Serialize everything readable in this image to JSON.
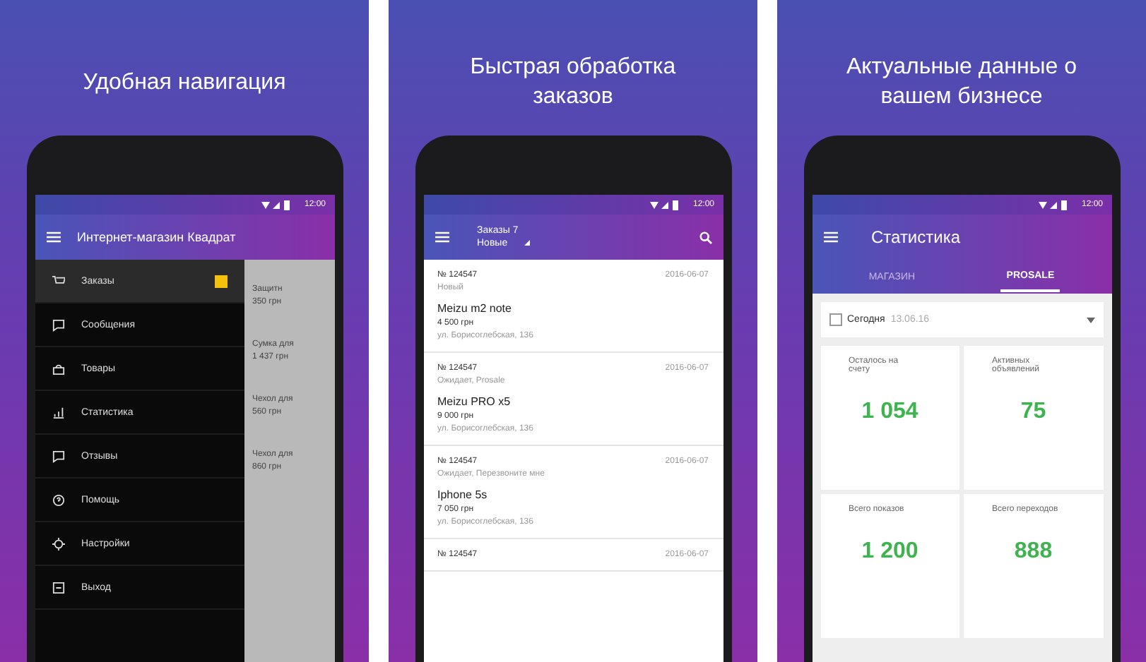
{
  "panels": [
    {
      "kind": "navigation",
      "headline": "Удобная навигация",
      "time": "12:00",
      "appbar_title": "Интернет-магазин Квадрат",
      "drawer_items": [
        {
          "label": "Заказы",
          "selected": true,
          "badge": true
        },
        {
          "label": "Сообщения",
          "selected": false,
          "badge": false
        },
        {
          "label": "Товары",
          "selected": false,
          "badge": false
        },
        {
          "label": "Статистика",
          "selected": false,
          "badge": false
        },
        {
          "label": "Отзывы",
          "selected": false,
          "badge": false
        },
        {
          "label": "Помощь",
          "selected": false,
          "badge": false
        },
        {
          "label": "Настройки",
          "selected": false,
          "badge": false
        },
        {
          "label": "Выход",
          "selected": false,
          "badge": false
        }
      ],
      "behind": [
        {
          "title": "Защитн",
          "price": "350 грн"
        },
        {
          "title": "Сумка для",
          "price": "1 437 грн"
        },
        {
          "title": "Чехол для",
          "price": "560 грн"
        },
        {
          "title": "Чехол для",
          "price": "860 грн"
        }
      ]
    },
    {
      "kind": "orders",
      "headline": "Быстрая обработка заказов",
      "time": "12:00",
      "appbar_title": "Заказы 7",
      "appbar_subtitle": "Новые",
      "orders": [
        {
          "number": "№ 124547",
          "date": "2016-06-07",
          "status": "Новый",
          "product": "Meizu m2 note",
          "price": "4 500 грн",
          "address": "ул. Борисоглебская, 136"
        },
        {
          "number": "№ 124547",
          "date": "2016-06-07",
          "status": "Ожидает, Prosale",
          "product": "Meizu PRO x5",
          "price": "9 000 грн",
          "address": "ул. Борисоглебская, 136"
        },
        {
          "number": "№ 124547",
          "date": "2016-06-07",
          "status": "Ожидает, Перезвоните мне",
          "product": "Iphone 5s",
          "price": "7 050 грн",
          "address": "ул. Борисоглебская, 136"
        },
        {
          "number": "№ 124547",
          "date": "2016-06-07"
        }
      ]
    },
    {
      "kind": "stats",
      "headline": "Актуальные данные о вашем бизнесе",
      "time": "12:00",
      "appbar_title": "Статистика",
      "tabs": [
        {
          "label": "МАГАЗИН",
          "selected": false
        },
        {
          "label": "PROSALE",
          "selected": true
        }
      ],
      "period": "Сегодня",
      "period_date": "13.06.16",
      "cards": [
        {
          "label": "Осталось на счету",
          "value": "1 054"
        },
        {
          "label": "Активных объявлений",
          "value": "75"
        },
        {
          "label": "Всего показов",
          "value": "1 200"
        },
        {
          "label": "Всего переходов",
          "value": "888"
        }
      ]
    }
  ]
}
